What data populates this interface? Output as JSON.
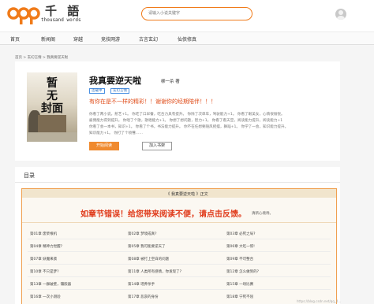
{
  "logo": {
    "cn": "千 語",
    "en": "thousand words",
    "color": "#f07b1a"
  },
  "search": {
    "placeholder": "请输入小说关键字"
  },
  "nav": [
    "首页",
    "新闻阁",
    "穿越",
    "竞技网游",
    "古言玄幻",
    "仙侠修真"
  ],
  "breadcrumb": "首页 > 玄幻言情 > 我真要逆天啦",
  "book": {
    "title": "我真要逆天啦",
    "author": "柳一杀  著",
    "tags": [
      "连载中",
      "玄幻言情"
    ],
    "tagline": "有你在是不一样的精彩！！谢谢你的经期陪伴！！！",
    "intro": [
      "你看了两小说，惹艺+1。   你吃了口早餐，吃合力具有提升。   你除了次单车，驾驶能力+1。 你看了眼美女，心情很愉悦。",
      "雇佣能力得到提升。 你唱了个歌，歌唱能力+1。 你想了想问题，智力+1。 你看了看天空，阅读能力提升，阅读能力+1",
      "你看了会一本书，知识+1。 你看了个书，书法能力提升。 你不在任想要随风摇摆，舞蹈+1。 你学了一会，知识能力提升。",
      "知识能力+1。 你打了个喷嚏……"
    ],
    "read_label": "开始阅读",
    "shelf_label": "加入书架"
  },
  "catalog": {
    "title": "目录",
    "panel_header": "《 我真要逆天啦 》正文",
    "notice": "如章节错误！给您带来阅读不便，请点击反馈。",
    "notice_sub": "清新心境待。",
    "chapters": [
      [
        "第01章 废柴根机",
        "第02章 梦境成真?",
        "第03章 必死之局?"
      ],
      [
        "第04章 精神力觉醒?",
        "第05章 我可能要逆天了",
        "第06章 大吃一惊!"
      ],
      [
        "第07章 妖魔来袭",
        "第08章 被打上空白的问题",
        "第09章 不可整合"
      ],
      [
        "第10章 不只是梦?",
        "第11章 人类所有感情，你发现了?",
        "第12章 怎么做到的?"
      ],
      [
        "第13章 一群破壁，镶嵌器",
        "第14章 瑶养杀手",
        "第15章 一场比赛"
      ],
      [
        "第16章 一次小测验",
        "第17章 悲哀的身份",
        "第18章 宁死不屈"
      ]
    ]
  },
  "watermark": "https://blog.csdn.net/qq_4..."
}
